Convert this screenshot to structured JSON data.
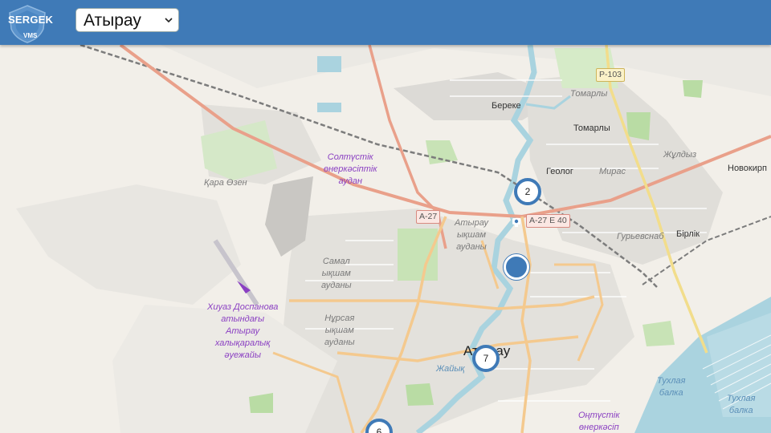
{
  "app": {
    "logo_text": "SERGEK",
    "logo_sub": "VMS"
  },
  "city_select": {
    "selected": "Атырау"
  },
  "map": {
    "labels": {
      "bereke": "Береке",
      "tomarly_italic": "Томарлы",
      "tomarly": "Томарлы",
      "p103": "P-103",
      "zhuldyz": "Жұлдыз",
      "novokirp": "Новокирп",
      "geolog": "Геолог",
      "miras": "Мирас",
      "north_ind": "Солтүстік\nөнеркәсіптік\nаудан",
      "kara_ozen": "Қара Өзен",
      "a27_west": "A-27",
      "a27_e40": "A-27\nE 40",
      "atyrau_district": "Атырау\nықшам\nауданы",
      "samal": "Самал\nықшам\nауданы",
      "guryevsnab": "Гурьевснаб",
      "birlik": "Бірлік",
      "airport": "Хиуаз Доспанова\nатындағы\nАтырау\nхалықаралық\nәуежайы",
      "nursaya": "Нұрсая\nықшам\nауданы",
      "city": "Атырау",
      "zhaiyk": "Жайық",
      "tukhlaya1": "Тухлая\nбалка",
      "tukhlaya2": "Тухлая\nбалка",
      "ontustik": "Оңтүстік\nөнеркәсіп"
    },
    "clusters": [
      {
        "count": "2"
      },
      {
        "count": "7"
      },
      {
        "count": "6"
      }
    ],
    "camera_marker": "camera-icon"
  }
}
